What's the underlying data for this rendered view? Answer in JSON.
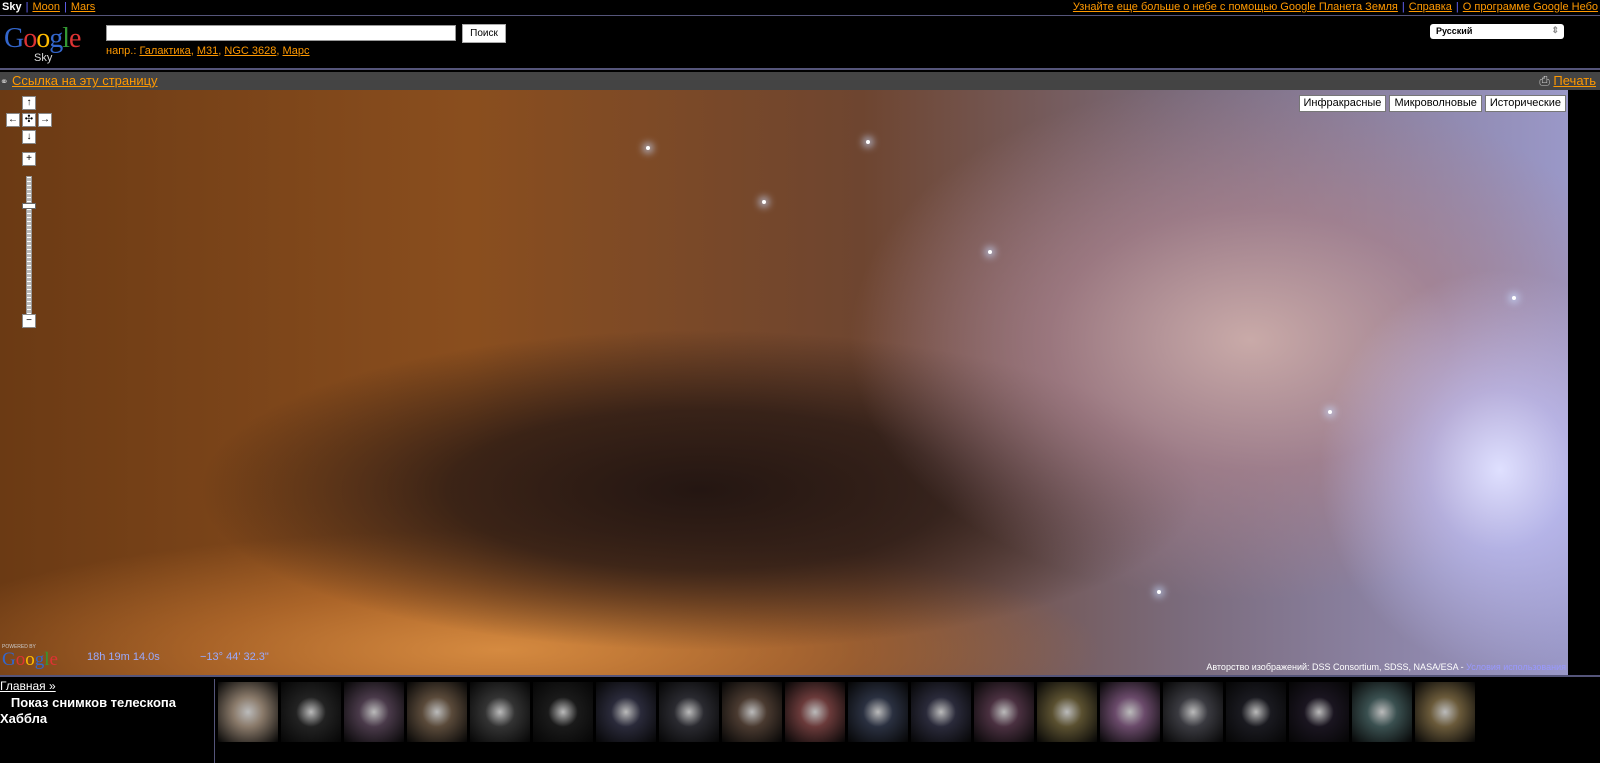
{
  "topbar": {
    "sky": "Sky",
    "moon": "Moon",
    "mars": "Mars",
    "earth_link": "Узнайте еще больше о небе с помощью Google Планета Земля",
    "help": "Справка",
    "about": "О программе Google Небо"
  },
  "header": {
    "logo": "Google",
    "logo_sub": "Sky",
    "search_value": "",
    "search_button": "Поиск",
    "examples_prefix": "напр.:",
    "examples": [
      "Галактика",
      "M31",
      "NGC 3628",
      "Марс"
    ],
    "language": "Русский"
  },
  "linkbar": {
    "link": "Ссылка на эту страницу",
    "print": "Печать"
  },
  "map": {
    "types": [
      "Инфракрасные",
      "Микроволновые",
      "Исторические"
    ],
    "powered_by": "POWERED BY",
    "ra": "18h 19m 14.0s",
    "dec": "−13° 44' 32.3\"",
    "credit": "Авторство изображений: DSS Consortium, SDSS, NASA/ESA - ",
    "terms": "Условия использования"
  },
  "bottom": {
    "home": "Главная »",
    "title": "Показ снимков телескопа Хаббла"
  },
  "thumbnails": [
    "#8a7a6a",
    "#222",
    "#4a3a4a",
    "#5a4a3a",
    "#333",
    "#1a1a1a",
    "#2a2a3a",
    "#2a2a30",
    "#4a3a30",
    "#6a3a3a",
    "#2a3040",
    "#2a2a3a",
    "#4a3040",
    "#5a5030",
    "#6a4a6a",
    "#3a3a40",
    "#1a1a20",
    "#1a1520",
    "#3a5050",
    "#6a5a3a"
  ]
}
